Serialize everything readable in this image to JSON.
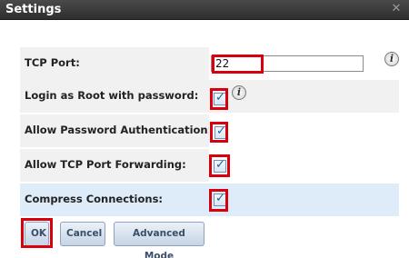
{
  "dialog": {
    "title": "Settings",
    "close_icon": "close-icon"
  },
  "fields": {
    "tcp_port": {
      "label": "TCP Port:",
      "value": "22"
    },
    "login_root": {
      "label": "Login as Root with password:",
      "checked": true
    },
    "allow_password": {
      "label": "Allow Password Authentication:",
      "checked": true
    },
    "allow_tcp_forwarding": {
      "label": "Allow TCP Port Forwarding:",
      "checked": true
    },
    "compress": {
      "label": "Compress Connections:",
      "checked": true
    }
  },
  "buttons": {
    "ok": "OK",
    "cancel": "Cancel",
    "advanced": "Advanced Mode"
  },
  "colors": {
    "highlight_box": "#d8000c",
    "row_highlight": "#deebf9",
    "titlebar": "#2e2e2e"
  }
}
